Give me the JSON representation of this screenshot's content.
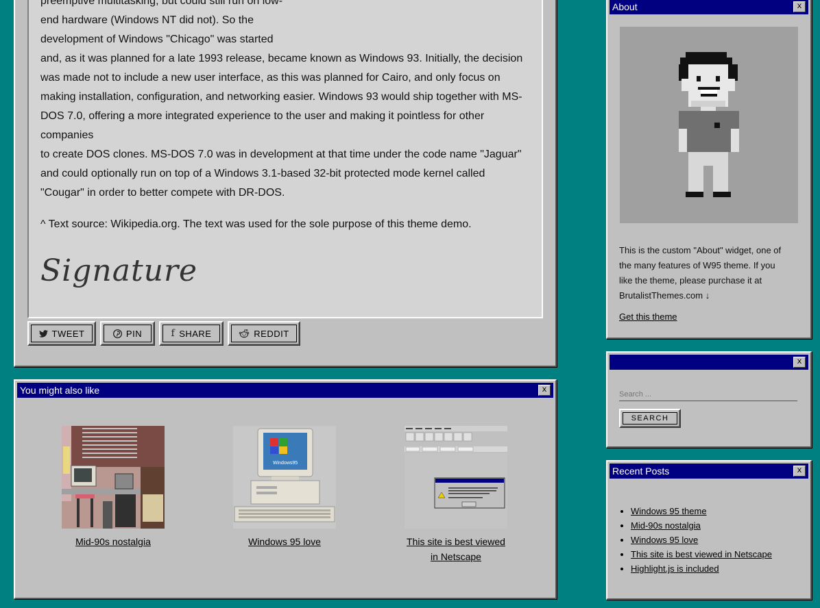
{
  "article": {
    "lines_narrow": [
      "preemptive multitasking, but could still run on low-",
      "end hardware (Windows NT did not). So the",
      "development of Windows \"Chicago\" was started"
    ],
    "lines_wide": [
      "and, as it was planned for a late 1993 release, became known as Windows 93. Initially, the decision",
      "was made not to include a new user interface, as this was planned for Cairo, and only focus on",
      "making installation, configuration, and networking easier. Windows 93 would ship together with MS-",
      "DOS 7.0, offering a more integrated experience to the user and making it pointless for other companies",
      "to create DOS clones. MS-DOS 7.0 was in development at that time under the code name \"Jaguar\"",
      "and could optionally run on top of a Windows 3.1-based 32-bit protected mode kernel called",
      "\"Cougar\" in order to better compete with DR-DOS."
    ],
    "source_note": "^ Text source: Wikipedia.org. The text was used for the sole purpose of this theme demo.",
    "signature": "Signature"
  },
  "share": {
    "tweet": "TWEET",
    "pin": "PIN",
    "share": "SHARE",
    "reddit": "REDDIT"
  },
  "related": {
    "title": "You might also like",
    "close": "x",
    "items": [
      {
        "label": "Mid-90s nostalgia"
      },
      {
        "label": "Windows 95 love"
      },
      {
        "label_line1": "This site is best viewed",
        "label_line2": "in Netscape"
      }
    ]
  },
  "about": {
    "title": "About",
    "close": "x",
    "text_lines": [
      "This is the custom \"About\" widget, one of",
      "the many features of W95 theme. If you",
      "like the theme, please purchase it at",
      "BrutalistThemes.com ↓"
    ],
    "link": "Get this theme"
  },
  "search_widget": {
    "title": "",
    "close": "x",
    "placeholder": "Search ...",
    "button": "SEARCH"
  },
  "recent": {
    "title": "Recent Posts",
    "close": "x",
    "items": [
      "Windows 95 theme",
      "Mid-90s nostalgia",
      "Windows 95 love",
      "This site is best viewed in Netscape",
      "Highlight.js is included"
    ]
  },
  "colors": {
    "desktop": "#008080",
    "window": "#c0c0c0",
    "titlebar": "#000080"
  }
}
